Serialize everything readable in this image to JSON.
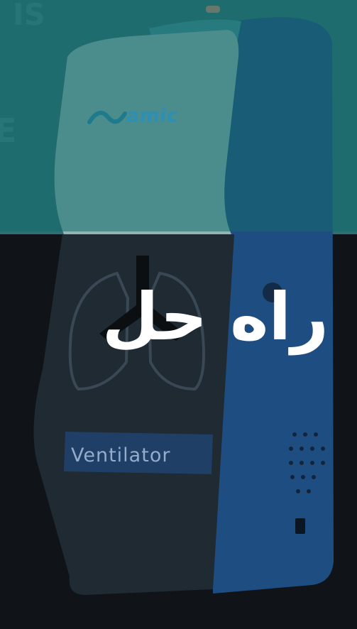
{
  "headline": "راه حل",
  "device": {
    "brand": "amic",
    "label": "Ventilator"
  },
  "colors": {
    "top_band": "#14696c",
    "bottom_background": "#0e1216",
    "device_body": "#1f4f86",
    "headline_text": "#ffffff"
  }
}
